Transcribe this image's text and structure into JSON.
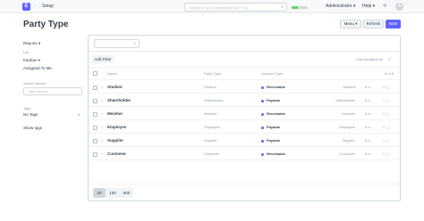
{
  "navbar": {
    "logo": "E",
    "breadcrumb_sep": "›",
    "breadcrumb": "Setup",
    "search_placeholder": "Search or type a command (Ctrl + G)",
    "search_icon": "⌕",
    "sync_progress": 0.4,
    "user_label": "Administrator ▾",
    "help_label": "Help ▾",
    "grid_icon": "⚒",
    "avatar_initial": "A"
  },
  "header": {
    "title": "Party Type",
    "menu_label": "Menu ▾",
    "refresh_label": "Refresh",
    "new_label": "New"
  },
  "sidebar": {
    "reports_label": "Reports ▾",
    "list_label": "List",
    "kanban_label": "Kanban ▾",
    "assigned_label": "Assigned To Me",
    "created_by_label": "Select Sender",
    "created_by_placeholder": "Office Name",
    "tags_label": "Tags",
    "no_tags_label": "No Tags",
    "no_tags_count": "6",
    "show_tags_label": "Show tags"
  },
  "list": {
    "filter_icon": "⌕",
    "add_filter_label": "Add Filter",
    "sort_label": "Last Modified On",
    "sort_icon": "≡",
    "columns": {
      "name": "Name",
      "party_type": "Party Type",
      "account_type": "Account Type",
      "count": "6 of 6"
    },
    "star_icon": "♥",
    "rows": [
      {
        "name": "Student",
        "party_type": "Student",
        "account_type": "Receivable",
        "doc_name": "Student",
        "modified": "8 d",
        "comments": "0 ◯"
      },
      {
        "name": "Shareholder",
        "party_type": "Shareholder",
        "account_type": "Payable",
        "doc_name": "Shareholder",
        "modified": "8 d",
        "comments": "0 ◯"
      },
      {
        "name": "Member",
        "party_type": "Member",
        "account_type": "Receivable",
        "doc_name": "Member",
        "modified": "8 d",
        "comments": "0 ◯"
      },
      {
        "name": "Employee",
        "party_type": "Employee",
        "account_type": "Payable",
        "doc_name": "Employee",
        "modified": "8 d",
        "comments": "0 ◯"
      },
      {
        "name": "Supplier",
        "party_type": "Supplier",
        "account_type": "Payable",
        "doc_name": "Supplier",
        "modified": "8 d",
        "comments": "0 ◯"
      },
      {
        "name": "Customer",
        "party_type": "Customer",
        "account_type": "Receivable",
        "doc_name": "Customer",
        "modified": "8 d",
        "comments": "0 ◯"
      }
    ],
    "page_sizes": [
      "20",
      "100",
      "500"
    ]
  }
}
